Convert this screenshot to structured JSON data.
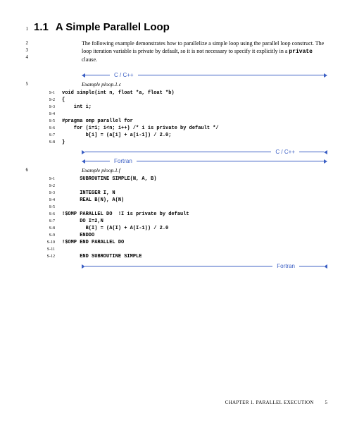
{
  "heading": {
    "lineNum": "1",
    "num": "1.1",
    "title": "A Simple Parallel Loop"
  },
  "para": {
    "lines": [
      "2",
      "3",
      "4"
    ],
    "text_before": "The following example demonstrates how to parallelize a simple loop using the parallel loop construct. The loop iteration variable is private by default, so it is not necessary to specify it explicitly in a ",
    "mono": "private",
    "text_after": " clause."
  },
  "sep": {
    "ccpp": "C / C++",
    "fortran": "Fortran"
  },
  "ex1": {
    "lineNum": "5",
    "caption": "Example ploop.1.c",
    "code": [
      {
        "n": "S-1",
        "t": "void simple(int n, float *a, float *b)"
      },
      {
        "n": "S-2",
        "t": "{"
      },
      {
        "n": "S-3",
        "t": "    int i;"
      },
      {
        "n": "S-4",
        "t": ""
      },
      {
        "n": "S-5",
        "t": "#pragma omp parallel for"
      },
      {
        "n": "S-6",
        "t": "    for (i=1; i<n; i++) /* i is private by default */"
      },
      {
        "n": "S-7",
        "t": "        b[i] = (a[i] + a[i-1]) / 2.0;"
      },
      {
        "n": "S-8",
        "t": "}"
      }
    ]
  },
  "ex2": {
    "lineNum": "6",
    "caption": "Example ploop.1.f",
    "code": [
      {
        "n": "S-1",
        "t": "      SUBROUTINE SIMPLE(N, A, B)"
      },
      {
        "n": "S-2",
        "t": ""
      },
      {
        "n": "S-3",
        "t": "      INTEGER I, N"
      },
      {
        "n": "S-4",
        "t": "      REAL B(N), A(N)"
      },
      {
        "n": "S-5",
        "t": ""
      },
      {
        "n": "S-6",
        "t": "!$OMP PARALLEL DO  !I is private by default"
      },
      {
        "n": "S-7",
        "t": "      DO I=2,N"
      },
      {
        "n": "S-8",
        "t": "        B(I) = (A(I) + A(I-1)) / 2.0"
      },
      {
        "n": "S-9",
        "t": "      ENDDO"
      },
      {
        "n": "S-10",
        "t": "!$OMP END PARALLEL DO"
      },
      {
        "n": "S-11",
        "t": ""
      },
      {
        "n": "S-12",
        "t": "      END SUBROUTINE SIMPLE"
      }
    ]
  },
  "footer": {
    "chapter": "CHAPTER 1.  PARALLEL EXECUTION",
    "page": "5"
  }
}
